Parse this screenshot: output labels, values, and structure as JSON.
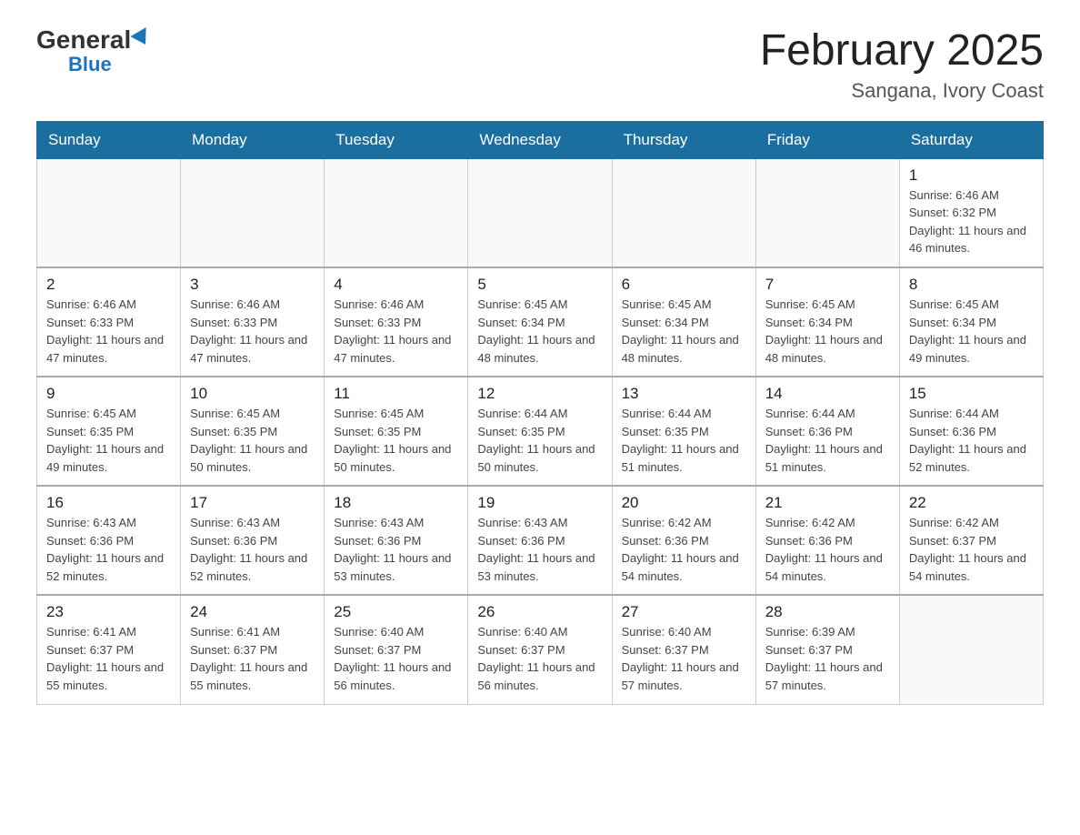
{
  "header": {
    "logo_general": "General",
    "logo_blue": "Blue",
    "month_title": "February 2025",
    "location": "Sangana, Ivory Coast"
  },
  "days_of_week": [
    "Sunday",
    "Monday",
    "Tuesday",
    "Wednesday",
    "Thursday",
    "Friday",
    "Saturday"
  ],
  "weeks": [
    [
      {
        "day": "",
        "info": ""
      },
      {
        "day": "",
        "info": ""
      },
      {
        "day": "",
        "info": ""
      },
      {
        "day": "",
        "info": ""
      },
      {
        "day": "",
        "info": ""
      },
      {
        "day": "",
        "info": ""
      },
      {
        "day": "1",
        "info": "Sunrise: 6:46 AM\nSunset: 6:32 PM\nDaylight: 11 hours and 46 minutes."
      }
    ],
    [
      {
        "day": "2",
        "info": "Sunrise: 6:46 AM\nSunset: 6:33 PM\nDaylight: 11 hours and 47 minutes."
      },
      {
        "day": "3",
        "info": "Sunrise: 6:46 AM\nSunset: 6:33 PM\nDaylight: 11 hours and 47 minutes."
      },
      {
        "day": "4",
        "info": "Sunrise: 6:46 AM\nSunset: 6:33 PM\nDaylight: 11 hours and 47 minutes."
      },
      {
        "day": "5",
        "info": "Sunrise: 6:45 AM\nSunset: 6:34 PM\nDaylight: 11 hours and 48 minutes."
      },
      {
        "day": "6",
        "info": "Sunrise: 6:45 AM\nSunset: 6:34 PM\nDaylight: 11 hours and 48 minutes."
      },
      {
        "day": "7",
        "info": "Sunrise: 6:45 AM\nSunset: 6:34 PM\nDaylight: 11 hours and 48 minutes."
      },
      {
        "day": "8",
        "info": "Sunrise: 6:45 AM\nSunset: 6:34 PM\nDaylight: 11 hours and 49 minutes."
      }
    ],
    [
      {
        "day": "9",
        "info": "Sunrise: 6:45 AM\nSunset: 6:35 PM\nDaylight: 11 hours and 49 minutes."
      },
      {
        "day": "10",
        "info": "Sunrise: 6:45 AM\nSunset: 6:35 PM\nDaylight: 11 hours and 50 minutes."
      },
      {
        "day": "11",
        "info": "Sunrise: 6:45 AM\nSunset: 6:35 PM\nDaylight: 11 hours and 50 minutes."
      },
      {
        "day": "12",
        "info": "Sunrise: 6:44 AM\nSunset: 6:35 PM\nDaylight: 11 hours and 50 minutes."
      },
      {
        "day": "13",
        "info": "Sunrise: 6:44 AM\nSunset: 6:35 PM\nDaylight: 11 hours and 51 minutes."
      },
      {
        "day": "14",
        "info": "Sunrise: 6:44 AM\nSunset: 6:36 PM\nDaylight: 11 hours and 51 minutes."
      },
      {
        "day": "15",
        "info": "Sunrise: 6:44 AM\nSunset: 6:36 PM\nDaylight: 11 hours and 52 minutes."
      }
    ],
    [
      {
        "day": "16",
        "info": "Sunrise: 6:43 AM\nSunset: 6:36 PM\nDaylight: 11 hours and 52 minutes."
      },
      {
        "day": "17",
        "info": "Sunrise: 6:43 AM\nSunset: 6:36 PM\nDaylight: 11 hours and 52 minutes."
      },
      {
        "day": "18",
        "info": "Sunrise: 6:43 AM\nSunset: 6:36 PM\nDaylight: 11 hours and 53 minutes."
      },
      {
        "day": "19",
        "info": "Sunrise: 6:43 AM\nSunset: 6:36 PM\nDaylight: 11 hours and 53 minutes."
      },
      {
        "day": "20",
        "info": "Sunrise: 6:42 AM\nSunset: 6:36 PM\nDaylight: 11 hours and 54 minutes."
      },
      {
        "day": "21",
        "info": "Sunrise: 6:42 AM\nSunset: 6:36 PM\nDaylight: 11 hours and 54 minutes."
      },
      {
        "day": "22",
        "info": "Sunrise: 6:42 AM\nSunset: 6:37 PM\nDaylight: 11 hours and 54 minutes."
      }
    ],
    [
      {
        "day": "23",
        "info": "Sunrise: 6:41 AM\nSunset: 6:37 PM\nDaylight: 11 hours and 55 minutes."
      },
      {
        "day": "24",
        "info": "Sunrise: 6:41 AM\nSunset: 6:37 PM\nDaylight: 11 hours and 55 minutes."
      },
      {
        "day": "25",
        "info": "Sunrise: 6:40 AM\nSunset: 6:37 PM\nDaylight: 11 hours and 56 minutes."
      },
      {
        "day": "26",
        "info": "Sunrise: 6:40 AM\nSunset: 6:37 PM\nDaylight: 11 hours and 56 minutes."
      },
      {
        "day": "27",
        "info": "Sunrise: 6:40 AM\nSunset: 6:37 PM\nDaylight: 11 hours and 57 minutes."
      },
      {
        "day": "28",
        "info": "Sunrise: 6:39 AM\nSunset: 6:37 PM\nDaylight: 11 hours and 57 minutes."
      },
      {
        "day": "",
        "info": ""
      }
    ]
  ]
}
